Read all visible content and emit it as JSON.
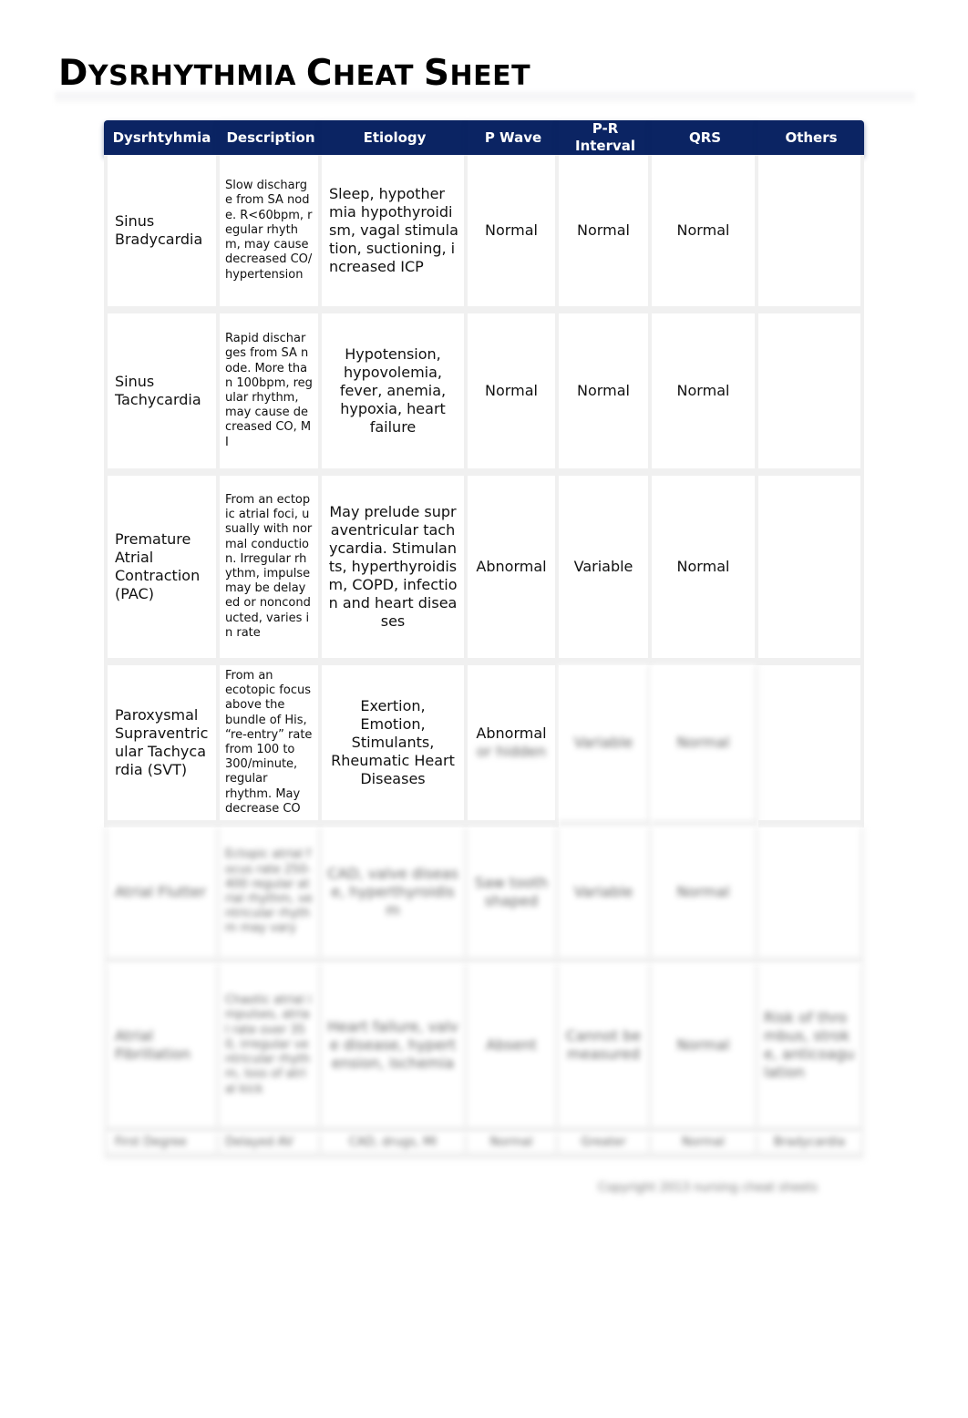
{
  "document": {
    "title": "Dysrhythmia Cheat Sheet",
    "title_parts": [
      {
        "text": "D",
        "size": "big"
      },
      {
        "text": "YSRHYTHMIA ",
        "size": "small"
      },
      {
        "text": "C",
        "size": "big"
      },
      {
        "text": "HEAT ",
        "size": "small"
      },
      {
        "text": "S",
        "size": "big"
      },
      {
        "text": "HEET",
        "size": "small"
      }
    ]
  },
  "table": {
    "header_color": "#0b2463",
    "columns": [
      "Dysrhtyhmia",
      "Description",
      "Etiology",
      "P Wave",
      "P-R Interval",
      "QRS",
      "Others"
    ],
    "rows": [
      {
        "name": "Sinus Bradycardia",
        "description": "Slow discharge from SA node. R<60bpm, regular rhythm, may cause decreased CO/hypertension",
        "etiology": "Sleep, hypothermia hypothyroidism, vagal stimulation, suctioning, increased ICP",
        "p_wave": "Normal",
        "pr_interval": "Normal",
        "qrs": "Normal",
        "others": ""
      },
      {
        "name": "Sinus Tachycardia",
        "description": "Rapid discharges from SA node. More than 100bpm, regular rhythm, may cause decreased CO, MI",
        "etiology": "Hypotension, hypovolemia, fever, anemia, hypoxia, heart failure",
        "p_wave": "Normal",
        "pr_interval": "Normal",
        "qrs": "Normal",
        "others": ""
      },
      {
        "name": "Premature Atrial Contraction (PAC)",
        "description": "From an ectopic atrial foci, usually with normal conduction. Irregular rhythm, impulse may be delayed or nonconducted, varies in rate",
        "etiology": "May prelude supraventricular tachycardia. Stimulants, hyperthyroidism, COPD, infection and heart diseases",
        "p_wave": "Abnormal",
        "pr_interval": "Variable",
        "qrs": "Normal",
        "others": ""
      },
      {
        "name": "Paroxysmal Supraventricular Tachycardia (SVT)",
        "description": "From an ecotopic focus above the bundle of His, “re-entry” rate from 100 to 300/minute, regular rhythm. May decrease CO",
        "etiology": "Exertion, Emotion, Stimulants, Rheumatic Heart Diseases",
        "p_wave": "Abnormal",
        "p_wave_blurred_tail": "or hidden",
        "pr_interval": "Variable",
        "qrs": "Normal",
        "others": "",
        "blurred_cells": [
          "pr_interval",
          "qrs"
        ]
      },
      {
        "name": "Atrial Flutter",
        "description": "Ectopic atrial focus rate 250-400 regular atrial rhythm, ventricular rhythm may vary",
        "etiology": "CAD, valve disease, hyperthyroidism",
        "p_wave": "Saw tooth shaped",
        "pr_interval": "Variable",
        "qrs": "Normal",
        "others": "",
        "blurred": true
      },
      {
        "name": "Atrial Fibrillation",
        "description": "Chaotic atrial impulses, atrial rate over 350, irregular ventricular rhythm, loss of atrial kick",
        "etiology": "Heart failure, valve disease, hypertension, ischemia",
        "p_wave": "Absent",
        "pr_interval": "Cannot be measured",
        "qrs": "Normal",
        "others": "Risk of thrombus, stroke, anticoagulation",
        "blurred": true
      },
      {
        "name": "First Degree",
        "description": "Delayed AV",
        "etiology": "CAD, drugs, MI",
        "p_wave": "Normal",
        "pr_interval": "Greater",
        "qrs": "Normal",
        "others": "Bradycardia",
        "blurred": true
      }
    ]
  },
  "footer": {
    "note": "Copyright 2013 nursing cheat sheets"
  }
}
